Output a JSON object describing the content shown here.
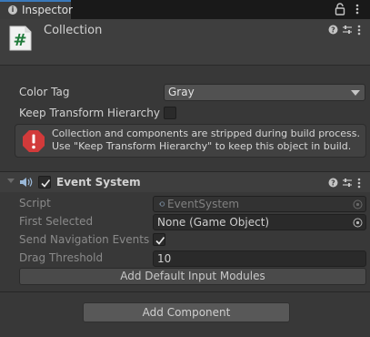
{
  "tab": {
    "title": "Inspector",
    "info_glyph": "i"
  },
  "header": {
    "object_name": "Collection",
    "script_glyph": "#"
  },
  "fields": {
    "color_tag_label": "Color Tag",
    "color_tag_value": "Gray",
    "keep_hierarchy_label": "Keep Transform Hierarchy",
    "keep_hierarchy_checked": false
  },
  "warning": {
    "line1": "Collection and components are stripped during build process.",
    "line2": "Use \"Keep Transform Hierarchy\" to keep this object in build."
  },
  "component": {
    "title": "Event System",
    "enabled": true,
    "script_label": "Script",
    "script_value": "EventSystem",
    "first_selected_label": "First Selected",
    "first_selected_value": "None (Game Object)",
    "send_nav_label": "Send Navigation Events",
    "send_nav_checked": true,
    "drag_threshold_label": "Drag Threshold",
    "drag_threshold_value": "10",
    "add_modules_label": "Add Default Input Modules"
  },
  "add_component_label": "Add Component",
  "colors": {
    "accent_tab": "#3a79bb",
    "script_icon": "#1f7a3a",
    "warning_icon": "#d23a3a"
  }
}
